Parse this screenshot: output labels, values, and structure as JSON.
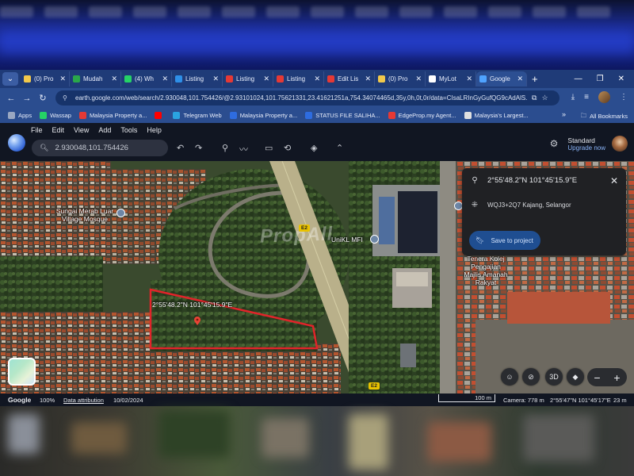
{
  "browser": {
    "tabs": [
      {
        "title": "(0) Pro",
        "favicon_color": "#f1c84b"
      },
      {
        "title": "Mudah",
        "favicon_color": "#2aa84a"
      },
      {
        "title": "(4) Wh",
        "favicon_color": "#25d366"
      },
      {
        "title": "Listing",
        "favicon_color": "#2e8fe8"
      },
      {
        "title": "Listing",
        "favicon_color": "#e53935"
      },
      {
        "title": "Listing",
        "favicon_color": "#e53935"
      },
      {
        "title": "Edit Lis",
        "favicon_color": "#e53935"
      },
      {
        "title": "(0) Pro",
        "favicon_color": "#f1c84b"
      },
      {
        "title": "MyLot",
        "favicon_color": "#ffffff"
      },
      {
        "title": "Google",
        "favicon_color": "#4fa3ff"
      }
    ],
    "new_tab": "+",
    "url": "earth.google.com/web/search/2.930048,101.754426/@2.93101024,101.75621331,23.41621251a,754.34074465d,35y,0h,0t,0r/data=CIsaLRInGyGufQG9cAdAlS...",
    "bookmarks": [
      {
        "label": "Apps",
        "color": "#9aa7c2"
      },
      {
        "label": "Wassap",
        "color": "#25d366"
      },
      {
        "label": "Malaysia Property a...",
        "color": "#e53935"
      },
      {
        "label": "",
        "color": "#ff0000"
      },
      {
        "label": "Telegram Web",
        "color": "#2aa3e0"
      },
      {
        "label": "Malaysia Property a...",
        "color": "#2e6ce0"
      },
      {
        "label": "STATUS FILE SALIHA...",
        "color": "#2e6ce0"
      },
      {
        "label": "EdgeProp.my Agent...",
        "color": "#e53935"
      },
      {
        "label": "Malaysia's Largest...",
        "color": "#e0e0e0"
      }
    ],
    "all_bookmarks": "All Bookmarks"
  },
  "earth": {
    "menu": [
      "File",
      "Edit",
      "View",
      "Add",
      "Tools",
      "Help"
    ],
    "search_value": "2.930048,101.754426",
    "account": {
      "plan": "Standard",
      "upgrade": "Upgrade now"
    },
    "map_labels": {
      "mosque": "Sungai Merab Luar Village Mosque",
      "unikl": "UniKL MFI",
      "kolej": "Tenera Kolej Pengajian Majlis Amanah Rakyat",
      "pin_coord": "2°55'48.2\"N 101°45'15.9\"E",
      "road1": "E2",
      "road2": "E2",
      "watermark": "PropAll"
    },
    "info_card": {
      "coordinates": "2°55'48.2\"N 101°45'15.9\"E",
      "plus_code": "WQJ3+2Q7 Kajang, Selangor",
      "save_button": "Save to project"
    },
    "controls": {
      "three_d": "3D",
      "zoom_out": "−",
      "zoom_in": "+"
    },
    "status": {
      "brand": "Google",
      "zoom_pct": "100%",
      "attribution": "Data attribution",
      "date": "10/02/2024",
      "scale": "100 m",
      "camera": "Camera: 778 m",
      "cursor": "2°55'47\"N 101°45'17\"E",
      "elevation": "23 m"
    }
  }
}
